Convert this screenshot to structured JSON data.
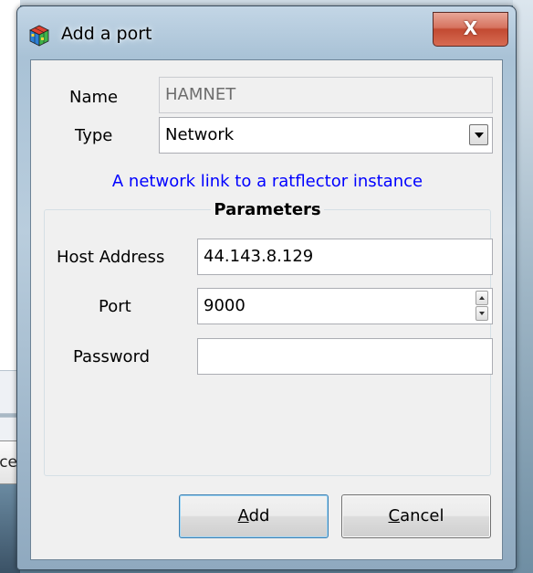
{
  "background": {
    "partial_button_label": "ce"
  },
  "dialog": {
    "title": "Add a port",
    "close_glyph": "X",
    "icon": "app-cube-icon"
  },
  "form": {
    "name_label": "Name",
    "name_value": "HAMNET",
    "type_label": "Type",
    "type_value": "Network",
    "type_description": "A network link to a ratflector instance"
  },
  "parameters": {
    "group_title": "Parameters",
    "host_label": "Host Address",
    "host_value": "44.143.8.129",
    "port_label": "Port",
    "port_value": "9000",
    "password_label": "Password",
    "password_value": ""
  },
  "buttons": {
    "add_accel": "A",
    "add_rest": "dd",
    "cancel_accel": "C",
    "cancel_rest": "ancel"
  },
  "colors": {
    "description_text": "#0000ff",
    "close_button": "#c24a32"
  }
}
